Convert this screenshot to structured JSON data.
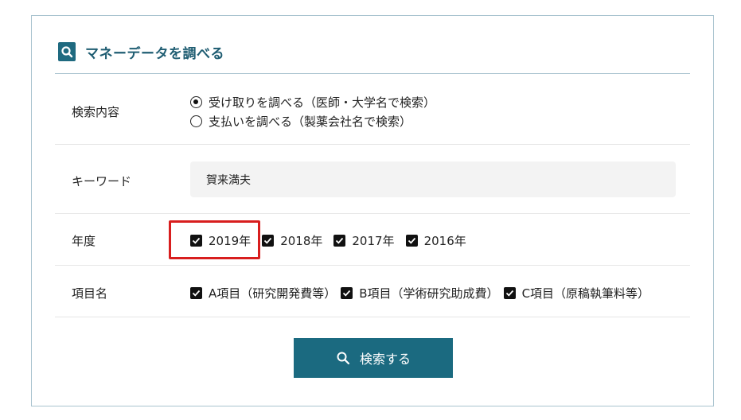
{
  "header": {
    "title": "マネーデータを調べる",
    "icon": "search-document-icon"
  },
  "form": {
    "search_type": {
      "label": "検索内容",
      "options": [
        {
          "label": "受け取りを調べる（医師・大学名で検索）",
          "selected": true
        },
        {
          "label": "支払いを調べる（製薬会社名で検索）",
          "selected": false
        }
      ]
    },
    "keyword": {
      "label": "キーワード",
      "value": "賀来満夫"
    },
    "year": {
      "label": "年度",
      "options": [
        {
          "label": "2019年",
          "checked": true
        },
        {
          "label": "2018年",
          "checked": true
        },
        {
          "label": "2017年",
          "checked": true
        },
        {
          "label": "2016年",
          "checked": true
        }
      ]
    },
    "item_name": {
      "label": "項目名",
      "options": [
        {
          "label": "A項目（研究開発費等）",
          "checked": true
        },
        {
          "label": "B項目（学術研究助成費）",
          "checked": true
        },
        {
          "label": "C項目（原稿執筆料等）",
          "checked": true
        }
      ]
    }
  },
  "search_button": {
    "label": "検索する"
  },
  "colors": {
    "accent": "#1b6a80",
    "highlight": "#d81e1e",
    "border": "#a9c3cf"
  }
}
